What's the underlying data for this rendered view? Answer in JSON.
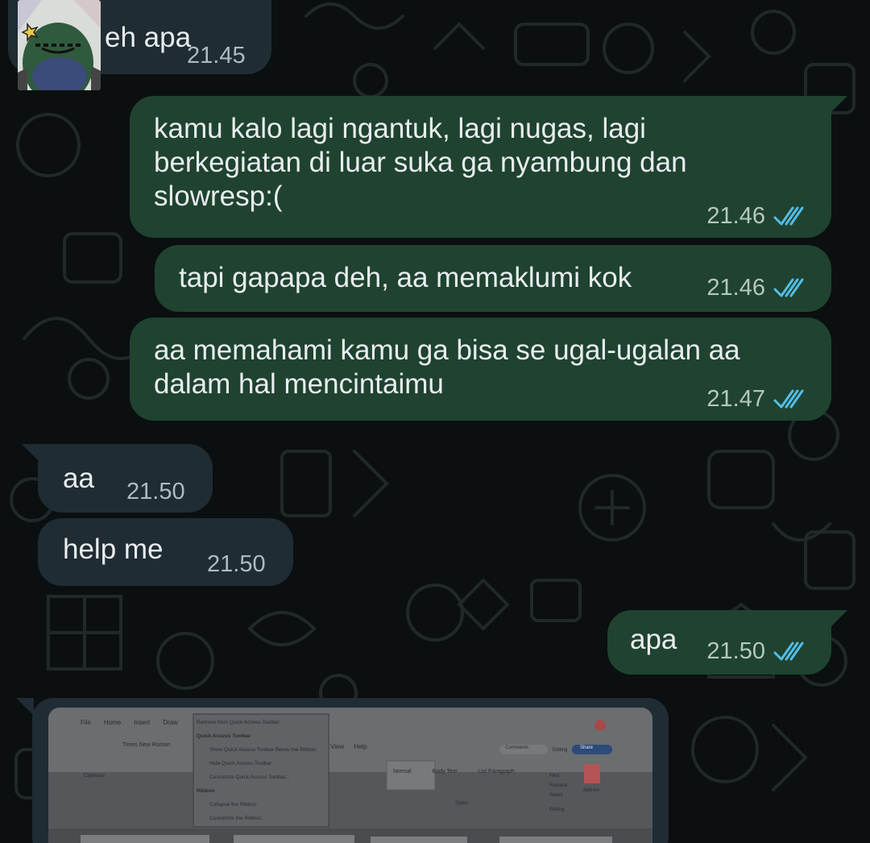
{
  "messages": [
    {
      "id": "m1",
      "dir": "in",
      "text": "eh apa",
      "time": "21.45",
      "sticker": "frog-sticker"
    },
    {
      "id": "m2",
      "dir": "out",
      "text": "kamu kalo lagi ngantuk, lagi nugas, lagi\nberkegiatan di luar suka ga nyambung dan\nslowresp:(",
      "time": "21.46",
      "status": "read-ticks-icon"
    },
    {
      "id": "m3",
      "dir": "out",
      "text": "tapi gapapa deh, aa memaklumi kok",
      "time": "21.46",
      "status": "read-ticks-icon"
    },
    {
      "id": "m4",
      "dir": "out",
      "text": "aa memahami kamu ga bisa se ugal-ugalan aa\ndalam hal mencintaimu",
      "time": "21.47",
      "status": "read-ticks-icon"
    },
    {
      "id": "m5",
      "dir": "in",
      "text": "aa",
      "time": "21.50"
    },
    {
      "id": "m6",
      "dir": "in",
      "text": "help me",
      "time": "21.50"
    },
    {
      "id": "m7",
      "dir": "out",
      "text": "apa",
      "time": "21.50",
      "status": "read-ticks-icon"
    }
  ],
  "photo": {
    "ribbon_tabs": [
      "File",
      "Home",
      "Insert",
      "Draw",
      "View",
      "Help"
    ],
    "menu_items": [
      "Remove from Quick Access Toolbar",
      "Quick Access Toolbar",
      "Show Quick Access Toolbar Below the Ribbon",
      "Hide Quick Access Toolbar",
      "Customize Quick Access Toolbar...",
      "Ribbon",
      "Collapse the Ribbon",
      "Customize the Ribbon..."
    ],
    "font_name": "Times New Roman",
    "styles": [
      "Normal",
      "Body Text",
      "List Paragraph"
    ],
    "group_labels": [
      "Clipboard",
      "Styles",
      "Editing"
    ],
    "side_labels": [
      "Comments",
      "Editing",
      "Share",
      "Find",
      "Replace",
      "Select",
      "Add-ins"
    ]
  },
  "colors": {
    "background": "#0b0f10",
    "incoming_bubble": "#202c33",
    "outgoing_bubble": "#1f4330",
    "tick_blue": "#53bdeb"
  }
}
